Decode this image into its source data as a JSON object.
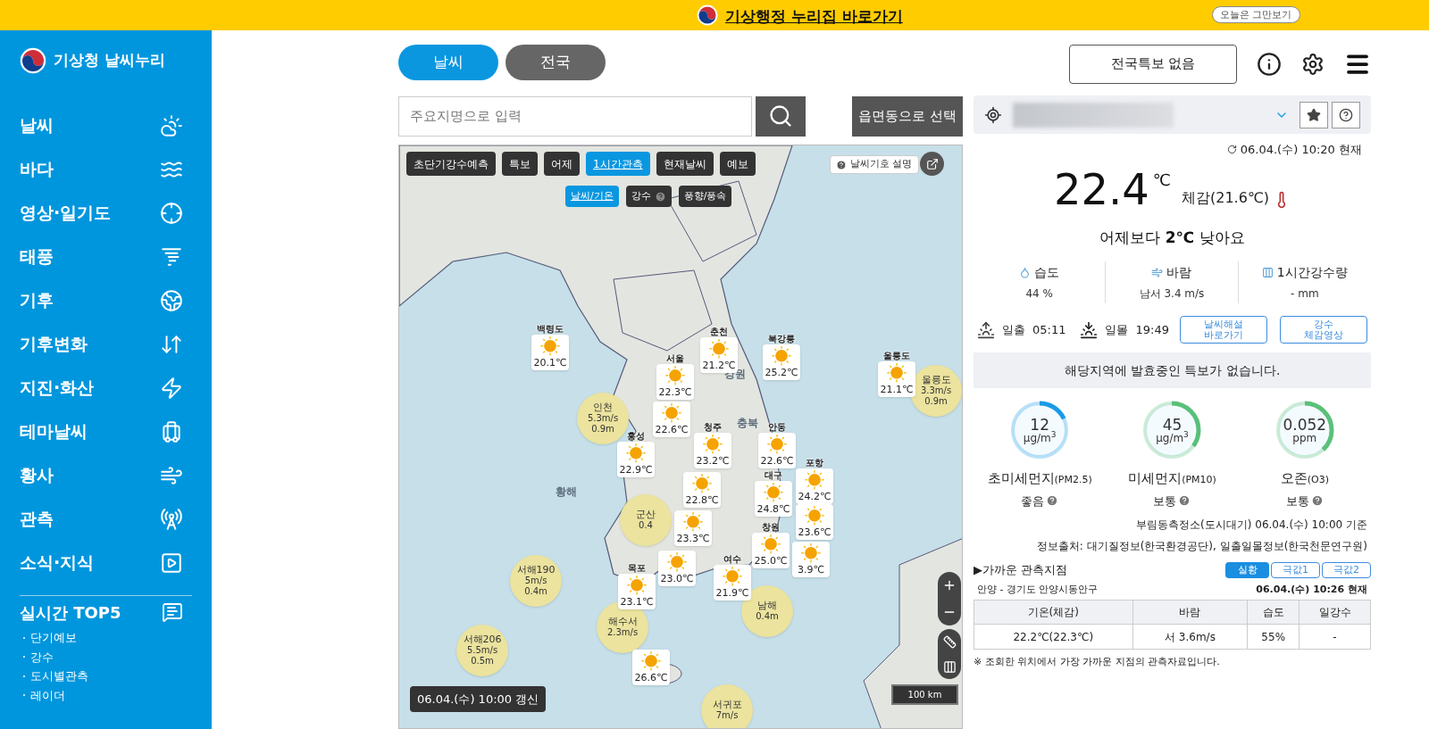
{
  "banner": {
    "link": "기상행정 누리집 바로가기",
    "dismiss": "오늘은 그만보기"
  },
  "sidebar": {
    "title": "기상청 날씨누리",
    "items": [
      "날씨",
      "바다",
      "영상·일기도",
      "태풍",
      "기후",
      "기후변화",
      "지진·화산",
      "테마날씨",
      "황사",
      "관측",
      "소식·지식"
    ],
    "top5": {
      "title": "실시간 TOP5",
      "items": [
        "단기예보",
        "강수",
        "도시별관측",
        "레이더"
      ]
    }
  },
  "tabs": [
    {
      "label": "날씨",
      "selected": true
    },
    {
      "label": "전국",
      "selected": false
    }
  ],
  "header": {
    "warning_button": "전국특보 없음"
  },
  "search": {
    "placeholder": "주요지명으로 입력",
    "region_button": "읍면동으로 선택"
  },
  "map": {
    "layer_tabs": [
      {
        "label": "초단기강수예측",
        "selected": false
      },
      {
        "label": "특보",
        "selected": false
      },
      {
        "label": "어제",
        "selected": false
      },
      {
        "label": "1시간관측",
        "selected": true
      },
      {
        "label": "현재날씨",
        "selected": false
      },
      {
        "label": "예보",
        "selected": false
      }
    ],
    "sub_tabs": [
      {
        "label": "날씨/기온",
        "selected": true,
        "help": false
      },
      {
        "label": "강수",
        "selected": false,
        "help": true
      },
      {
        "label": "풍향/풍속",
        "selected": false,
        "help": false
      }
    ],
    "legend_button": "날씨기호 설명",
    "labels": [
      "황해",
      "강원",
      "충북"
    ],
    "buoys": [
      {
        "name": "인천",
        "wind": "5.3m/s",
        "wave": "0.9m"
      },
      {
        "name": "울릉도",
        "wind": "3.3m/s",
        "wave": "0.9m"
      },
      {
        "name": "서해190",
        "wind": "5m/s",
        "wave": "0.4m"
      },
      {
        "name": "서해206",
        "wind": "5.5m/s",
        "wave": "0.5m"
      },
      {
        "name": "군산",
        "wave": "0.4"
      },
      {
        "name": "해수서",
        "wind": "2.3m/s"
      },
      {
        "name": "남해",
        "wave": "0.4m"
      },
      {
        "name": "서귀포",
        "wind": "7m/s"
      }
    ],
    "stations": [
      {
        "name": "백령도",
        "temp": "20.1℃"
      },
      {
        "name": "춘천",
        "temp": "21.2℃"
      },
      {
        "name": "북강릉",
        "temp": "25.2℃"
      },
      {
        "name": "서울",
        "temp": "22.3℃"
      },
      {
        "name": "울릉도",
        "temp": "21.1℃"
      },
      {
        "temp": "22.6℃"
      },
      {
        "name": "청주",
        "temp": "23.2℃"
      },
      {
        "name": "안동",
        "temp": "22.6℃"
      },
      {
        "name": "홍성",
        "temp": "22.9℃"
      },
      {
        "temp": "22.8℃"
      },
      {
        "name": "포항",
        "temp": "24.2℃"
      },
      {
        "name": "대구",
        "temp": "24.8℃"
      },
      {
        "temp": "23.3℃"
      },
      {
        "temp": "23.6℃"
      },
      {
        "name": "창원",
        "temp": "25.0℃"
      },
      {
        "temp": "3.9℃"
      },
      {
        "temp": "23.0℃"
      },
      {
        "name": "여수",
        "temp": "21.9℃"
      },
      {
        "name": "목포",
        "temp": "23.1℃"
      },
      {
        "temp": "26.6℃"
      }
    ],
    "scale": "100 km",
    "updated": "06.04.(수) 10:00 갱신"
  },
  "current": {
    "time": "06.04.(수) 10:20 현재",
    "temp": "22.4",
    "unit": "℃",
    "feels": "체감(21.6℃)",
    "compare": "어제보다 **2℃** 낮아요"
  },
  "stats": [
    {
      "label": "습도",
      "value": "44",
      "unit": "%"
    },
    {
      "label": "바람",
      "value": "남서 3.4",
      "unit": "m/s"
    },
    {
      "label": "1시간강수량",
      "value": "-",
      "unit": "mm"
    }
  ],
  "sun": {
    "sunrise_label": "일출",
    "sunrise": "05:11",
    "sunset_label": "일몰",
    "sunset": "19:49"
  },
  "links": [
    {
      "lines": [
        "날씨해설",
        "바로가기"
      ]
    },
    {
      "lines": [
        "강수",
        "체감영상"
      ]
    }
  ],
  "alert": "해당지역에 발효중인 특보가 없습니다.",
  "air": [
    {
      "value": "12",
      "unit": "μg/m$^{3}$",
      "name": "초미세먼지",
      "code": "(PM2.5)",
      "grade": "좋음",
      "level": 0.18,
      "color": "#1a9be6"
    },
    {
      "value": "45",
      "unit": "μg/m$^{3}$",
      "name": "미세먼지",
      "code": "(PM10)",
      "grade": "보통",
      "level": 0.35,
      "color": "#5ac07a"
    },
    {
      "value": "0.052",
      "unit": "ppm",
      "name": "오존",
      "code": "(O3)",
      "grade": "보통",
      "level": 0.38,
      "color": "#5ac07a"
    }
  ],
  "air_station": "부림동측정소(도시대기) 06.04.(수) 10:00 기준",
  "source": "정보출처: 대기질정보(한국환경공단), 일출일몰정보(한국천문연구원)",
  "nearby": {
    "title": "▶가까운 관측지점",
    "tabs": [
      {
        "label": "실황",
        "selected": true
      },
      {
        "label": "극값1",
        "selected": false
      },
      {
        "label": "극값2",
        "selected": false
      }
    ],
    "station": "안양 - 경기도 안양시동안구",
    "time": "06.04.(수) 10:26 현재",
    "columns": [
      "기온(체감)",
      "바람",
      "습도",
      "일강수"
    ],
    "rows": [
      [
        "22.2℃(22.3℃)",
        "서 3.6m/s",
        "55%",
        "-"
      ]
    ],
    "note": "※ 조회한 위치에서 가장 가까운 지점의 관측자료입니다."
  }
}
